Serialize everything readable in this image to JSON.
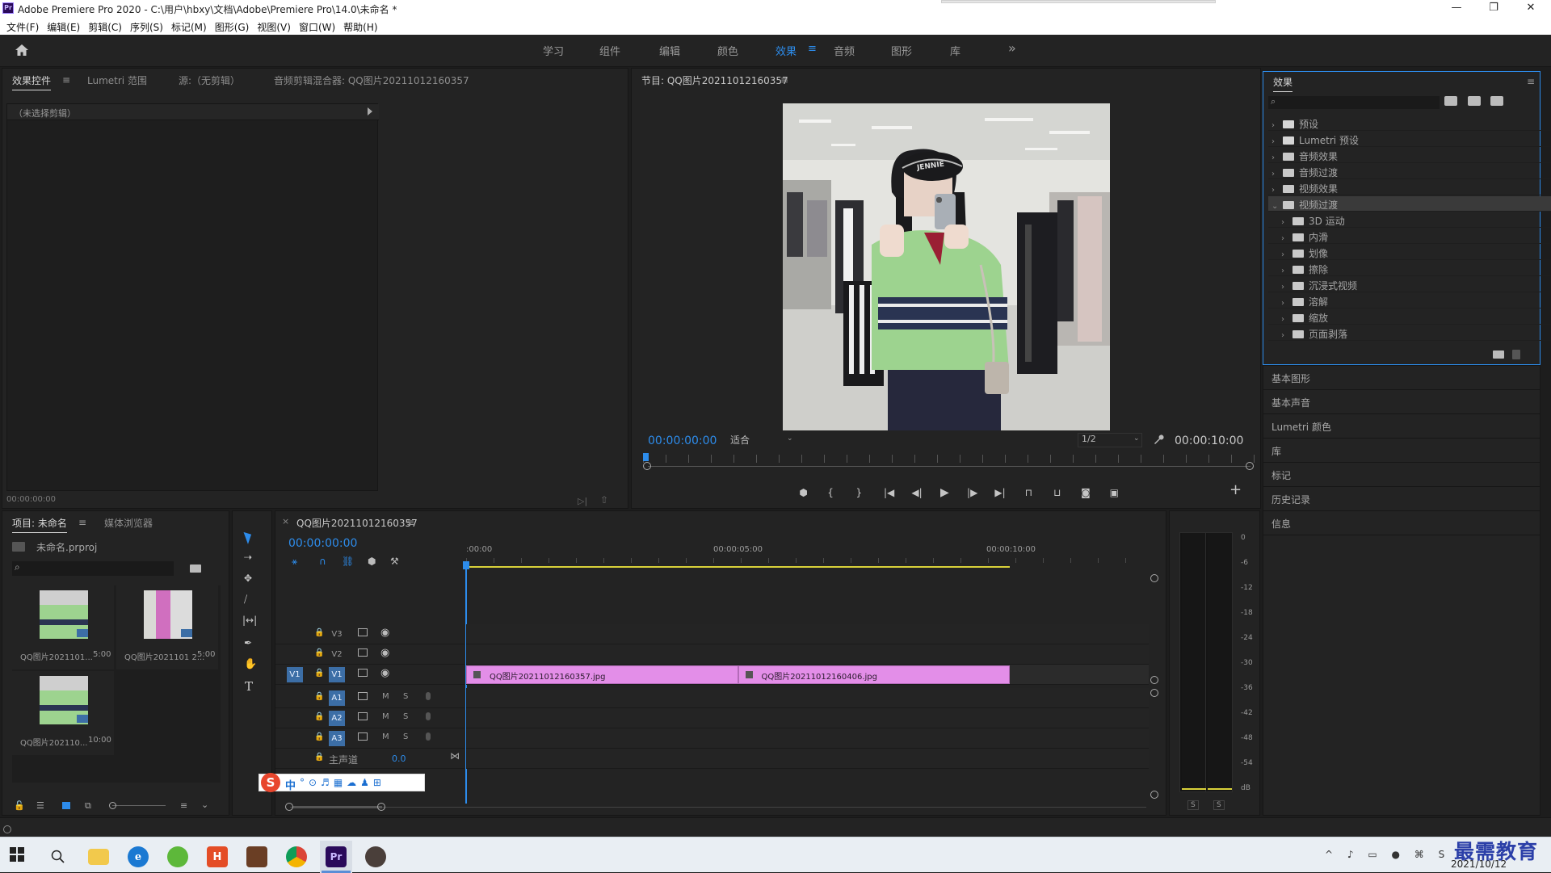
{
  "window": {
    "app_icon": "Pr",
    "title": "Adobe Premiere Pro 2020 - C:\\用户\\hbxy\\文档\\Adobe\\Premiere Pro\\14.0\\未命名 *",
    "minimize": "—",
    "maximize": "❐",
    "close": "✕"
  },
  "menu": [
    "文件(F)",
    "编辑(E)",
    "剪辑(C)",
    "序列(S)",
    "标记(M)",
    "图形(G)",
    "视图(V)",
    "窗口(W)",
    "帮助(H)"
  ],
  "workspaces": {
    "items": [
      "学习",
      "组件",
      "编辑",
      "颜色",
      "效果",
      "音频",
      "图形",
      "库"
    ],
    "active_index": 4,
    "more": "»"
  },
  "effect_controls": {
    "tabs": [
      "效果控件",
      "Lumetri 范围",
      "源:（无剪辑）",
      "音频剪辑混合器: QQ图片20211012160357"
    ],
    "no_clip": "（未选择剪辑）",
    "timecode": "00:00:00:00"
  },
  "program": {
    "title": "节目: QQ图片20211012160357",
    "timecode": "00:00:00:00",
    "fit": "适合",
    "quality": "1/2",
    "duration": "00:00:10:00",
    "sticker_text": "JENNIE"
  },
  "effects_panel": {
    "title": "效果",
    "items": [
      {
        "label": "预设",
        "depth": 0,
        "expanded": false
      },
      {
        "label": "Lumetri 预设",
        "depth": 0,
        "expanded": false
      },
      {
        "label": "音频效果",
        "depth": 0,
        "expanded": false
      },
      {
        "label": "音频过渡",
        "depth": 0,
        "expanded": false
      },
      {
        "label": "视频效果",
        "depth": 0,
        "expanded": false
      },
      {
        "label": "视频过渡",
        "depth": 0,
        "expanded": true,
        "selected": true
      },
      {
        "label": "3D 运动",
        "depth": 1,
        "expanded": false
      },
      {
        "label": "内滑",
        "depth": 1,
        "expanded": false
      },
      {
        "label": "划像",
        "depth": 1,
        "expanded": false
      },
      {
        "label": "擦除",
        "depth": 1,
        "expanded": false
      },
      {
        "label": "沉浸式视频",
        "depth": 1,
        "expanded": false
      },
      {
        "label": "溶解",
        "depth": 1,
        "expanded": false
      },
      {
        "label": "缩放",
        "depth": 1,
        "expanded": false
      },
      {
        "label": "页面剥落",
        "depth": 1,
        "expanded": false
      }
    ]
  },
  "side_panels": [
    "基本图形",
    "基本声音",
    "Lumetri 颜色",
    "库",
    "标记",
    "历史记录",
    "信息"
  ],
  "project": {
    "tabs": [
      "项目: 未命名",
      "媒体浏览器"
    ],
    "file": "未命名.prproj",
    "items": [
      {
        "name": "QQ图片2021101...",
        "dur": "5:00"
      },
      {
        "name": "QQ图片2021101 2...",
        "dur": "5:00"
      },
      {
        "name": "QQ图片202110...",
        "dur": "10:00"
      }
    ]
  },
  "timeline": {
    "tab": "QQ图片20211012160357",
    "timecode": "00:00:00:00",
    "ruler": [
      ":00:00",
      "00:00:05:00",
      "00:00:10:00"
    ],
    "video_tracks": [
      "V3",
      "V2",
      "V1"
    ],
    "audio_tracks": [
      "A1",
      "A2",
      "A3"
    ],
    "source_patch": "V1",
    "mute": "M",
    "solo": "S",
    "master": "主声道",
    "master_value": "0.0",
    "clips": [
      {
        "name": "QQ图片20211012160357.jpg",
        "start": 0,
        "end": 5
      },
      {
        "name": "QQ图片20211012160406.jpg",
        "start": 5,
        "end": 10
      }
    ]
  },
  "meter": {
    "labels": [
      "0",
      "-6",
      "-12",
      "-18",
      "-24",
      "-30",
      "-36",
      "-42",
      "-48",
      "-54",
      "dB"
    ],
    "solo_buttons": [
      "S",
      "S"
    ]
  },
  "ime": {
    "logo": "S",
    "mode": "中"
  },
  "taskbar": {
    "date": "2021/10/12",
    "watermark": "最需教育",
    "pr_label": "Pr"
  },
  "colors": {
    "accent": "#2d8ceb",
    "clip": "#e38ee8",
    "panel": "#232323",
    "track_btn": "#3c6ea6"
  }
}
